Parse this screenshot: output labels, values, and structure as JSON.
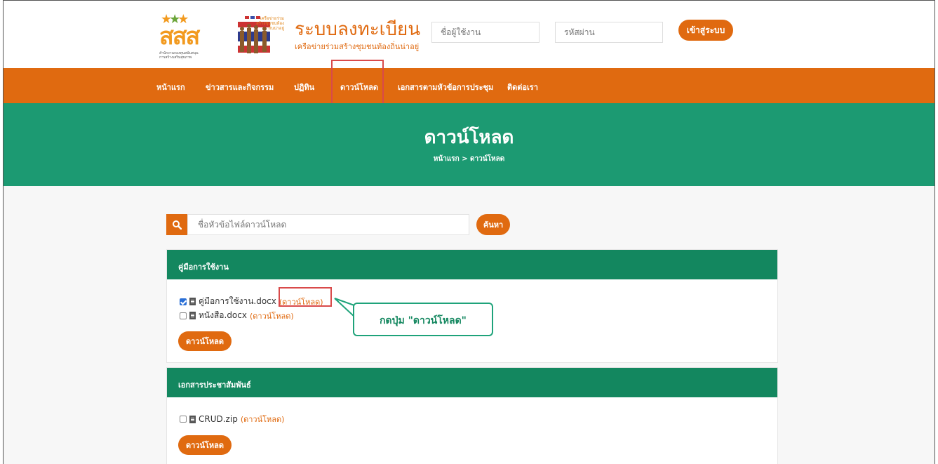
{
  "header": {
    "logo_sss_word": "สสส",
    "logo_sss_sub": "สำนักงานกองทุนสนับสนุนการสร้างเสริมสุขภาพ",
    "logo_network_text": "เครือข่ายร่วมสร้างชุมชนท้องถิ่นน่าอยู่",
    "site_title": "ระบบลงทะเบียน",
    "site_subtitle": "เครือข่ายร่วมสร้างชุมชนท้องถิ่นน่าอยู่",
    "username_placeholder": "ชื่อผู้ใช้งาน",
    "password_placeholder": "รหัสผ่าน",
    "login_label": "เข้าสู่ระบบ"
  },
  "nav": {
    "items": [
      {
        "label": "หน้าแรก"
      },
      {
        "label": "ข่าวสารและกิจกรรม"
      },
      {
        "label": "ปฏิทิน"
      },
      {
        "label": "ดาวน์โหลด"
      },
      {
        "label": "เอกสารตามหัวข้อการประชุม"
      },
      {
        "label": "ติดต่อเรา"
      }
    ]
  },
  "banner": {
    "title": "ดาวน์โหลด",
    "breadcrumb": "หน้าแรก >  ดาวน์โหลด"
  },
  "search": {
    "placeholder": "ชื่อหัวข้อไฟล์ดาวน์โหลด",
    "button_label": "ค้นหา"
  },
  "sections": [
    {
      "title": "คู่มือการใช้งาน",
      "files": [
        {
          "name": "คู่มือการใช้งาน.docx",
          "link": "(ดาวน์โหลด)",
          "checked": true
        },
        {
          "name": "หนังสือ.docx",
          "link": "(ดาวน์โหลด)",
          "checked": false
        }
      ],
      "button_label": "ดาวน์โหลด"
    },
    {
      "title": "เอกสารประชาสัมพันธ์",
      "files": [
        {
          "name": "CRUD.zip",
          "link": "(ดาวน์โหลด)",
          "checked": false
        }
      ],
      "button_label": "ดาวน์โหลด"
    }
  ],
  "annotation": {
    "callout_text": "กดปุ่ม \"ดาวน์โหลด\""
  },
  "colors": {
    "orange": "#e06a10",
    "green": "#1c9a72",
    "dark_green": "#13875f",
    "highlight_red": "#d94a4a"
  }
}
